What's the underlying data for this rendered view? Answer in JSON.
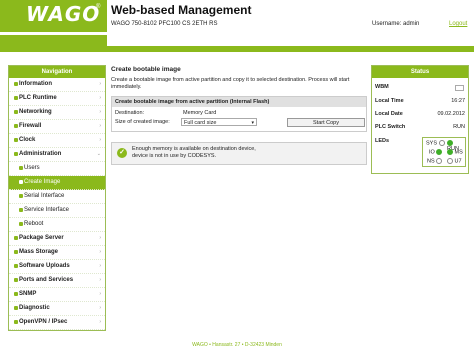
{
  "header": {
    "logo": "WAGO",
    "logo_mark": "®",
    "title": "Web-based Management",
    "device": "WAGO 750-8102 PFC100 CS 2ETH RS",
    "username": "Username: admin",
    "logout": "Logout",
    "brand_color": "#8bb91c"
  },
  "nav": {
    "header": "Navigation",
    "items": [
      {
        "label": "Information"
      },
      {
        "label": "PLC Runtime"
      },
      {
        "label": "Networking"
      },
      {
        "label": "Firewall"
      },
      {
        "label": "Clock"
      },
      {
        "label": "Administration"
      }
    ],
    "subitems": [
      {
        "label": "Users"
      },
      {
        "label": "Create Image"
      },
      {
        "label": "Serial Interface"
      },
      {
        "label": "Service Interface"
      },
      {
        "label": "Reboot"
      }
    ],
    "items2": [
      {
        "label": "Package Server"
      },
      {
        "label": "Mass Storage"
      },
      {
        "label": "Software Uploads"
      },
      {
        "label": "Ports and Services"
      },
      {
        "label": "SNMP"
      },
      {
        "label": "Diagnostic"
      },
      {
        "label": "OpenVPN / IPsec"
      }
    ]
  },
  "main": {
    "title": "Create bootable image",
    "description": "Create a bootable image from active partition and copy it to selected destination. Process will start immediately.",
    "box_header": "Create bootable image from active partition (Internal Flash)",
    "destination_label": "Destination:",
    "destination_value": "Memory Card",
    "size_label": "Size of created image:",
    "size_value": "Full card size",
    "start_button": "Start Copy",
    "notice_line1": "Enough memory is available on destination device,",
    "notice_line2": "device is not in use by CODESYS."
  },
  "status": {
    "header": "Status",
    "wbm_label": "WBM",
    "time_label": "Local Time",
    "time_value": "16:27",
    "date_label": "Local Date",
    "date_value": "09.02.2012",
    "plc_label": "PLC Switch",
    "plc_value": "RUN",
    "leds_label": "LEDs",
    "leds": {
      "sys": "SYS",
      "run": "RUN",
      "io": "IO",
      "ms": "MS",
      "ns": "NS",
      "u7": "U7"
    }
  },
  "footer": "WAGO • Hansastr. 27 • D-32423 Minden"
}
